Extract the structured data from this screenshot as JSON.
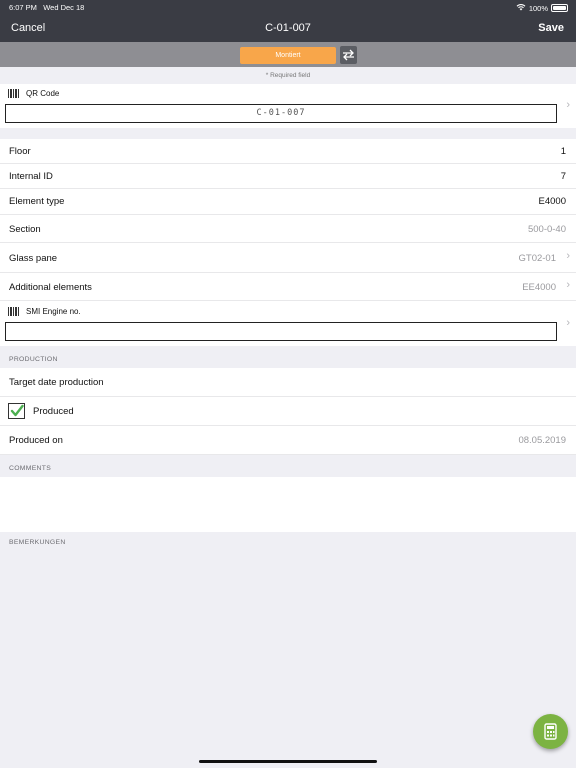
{
  "status": {
    "time": "6:07 PM",
    "date": "Wed Dec 18",
    "battery": "100%"
  },
  "nav": {
    "cancel": "Cancel",
    "title": "C-01-007",
    "save": "Save"
  },
  "state": {
    "label": "Montiert",
    "swap_icon": "swap-arrows-icon"
  },
  "required_note": "* Required field",
  "qr": {
    "label": "QR Code",
    "value": "C-01-007"
  },
  "rows": {
    "floor": {
      "label": "Floor",
      "value": "1"
    },
    "internal_id": {
      "label": "Internal ID",
      "value": "7"
    },
    "element_type": {
      "label": "Element type",
      "value": "E4000"
    },
    "section": {
      "label": "Section",
      "value": "500-0-40"
    },
    "glass_pane": {
      "label": "Glass pane",
      "value": "GT02-01"
    },
    "additional": {
      "label": "Additional elements",
      "value": "EE4000"
    }
  },
  "smi": {
    "label": "SMI Engine no.",
    "value": ""
  },
  "production": {
    "header": "PRODUCTION",
    "target_date": {
      "label": "Target date production",
      "value": ""
    },
    "produced": {
      "label": "Produced",
      "checked": true
    },
    "produced_on": {
      "label": "Produced on",
      "value": "08.05.2019"
    }
  },
  "comments": {
    "header": "COMMENTS",
    "value": ""
  },
  "bemerkungen": {
    "header": "BEMERKUNGEN"
  },
  "colors": {
    "nav_bg": "#3a3c44",
    "state_accent": "#f8a64a",
    "fab": "#7cb342"
  }
}
